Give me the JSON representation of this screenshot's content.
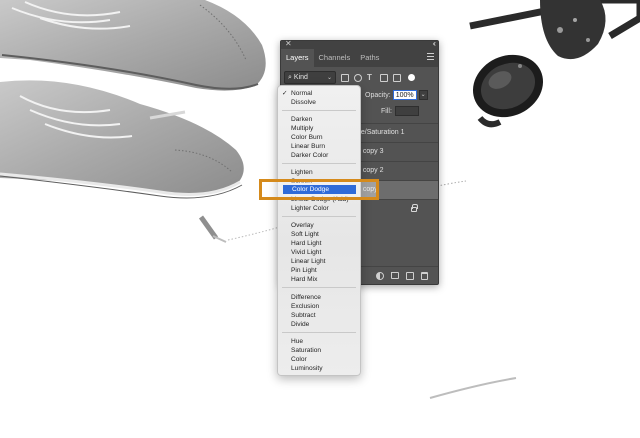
{
  "panel": {
    "tabs": [
      {
        "label": "Layers",
        "active": true
      },
      {
        "label": "Channels",
        "active": false
      },
      {
        "label": "Paths",
        "active": false
      }
    ],
    "filter_kind": "Kind",
    "opacity_label": "Opacity:",
    "opacity_value": "100%",
    "fill_label": "Fill:",
    "layers": [
      {
        "name": "ue/Saturation 1",
        "selected": false
      },
      {
        "name": "d copy 3",
        "selected": false
      },
      {
        "name": "d copy 2",
        "selected": false
      },
      {
        "name": "d copy",
        "selected": true
      }
    ]
  },
  "blend_menu": {
    "groups": [
      [
        "Normal",
        "Dissolve"
      ],
      [
        "Darken",
        "Multiply",
        "Color Burn",
        "Linear Burn",
        "Darker Color"
      ],
      [
        "Lighten",
        "Screen",
        "Color Dodge",
        "Linear Dodge (Add)",
        "Lighter Color"
      ],
      [
        "Overlay",
        "Soft Light",
        "Hard Light",
        "Vivid Light",
        "Linear Light",
        "Pin Light",
        "Hard Mix"
      ],
      [
        "Difference",
        "Exclusion",
        "Subtract",
        "Divide"
      ],
      [
        "Hue",
        "Saturation",
        "Color",
        "Luminosity"
      ]
    ],
    "checked": "Normal",
    "highlighted": "Color Dodge"
  },
  "colors": {
    "panel_bg": "#535353",
    "accent_blue": "#2f6bd8",
    "callout_orange": "#d58a1b"
  }
}
